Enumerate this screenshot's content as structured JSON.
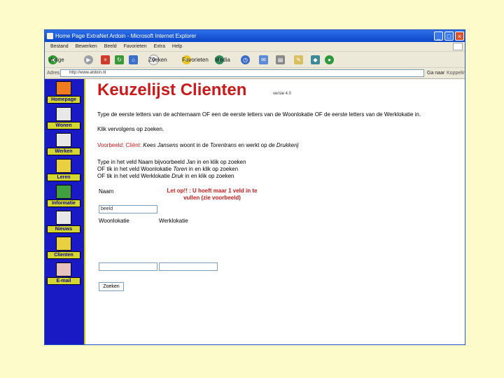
{
  "window": {
    "title": "Home Page ExtraNet Ardoin - Microsoft Internet Explorer",
    "minimize": "_",
    "maximize": "□",
    "close": "×"
  },
  "menu": [
    "Bestand",
    "Bewerken",
    "Beeld",
    "Favorieten",
    "Extra",
    "Help"
  ],
  "toolbar": {
    "back": "Vorige",
    "search": "Zoeken",
    "favorites": "Favorieten",
    "media": "Media"
  },
  "address": {
    "label": "Adres",
    "value": "http://www.ardoin.nl",
    "go": "Ga naar",
    "links": "Koppelingen"
  },
  "sidebar": {
    "items": [
      {
        "label": "Homepage",
        "icon": "homepage-icon"
      },
      {
        "label": "Wonen",
        "icon": "house-icon"
      },
      {
        "label": "Werken",
        "icon": "work-icon"
      },
      {
        "label": "Leren",
        "icon": "book-icon"
      },
      {
        "label": "Informatie",
        "icon": "info-icon"
      },
      {
        "label": "Nieuws",
        "icon": "news-icon"
      },
      {
        "label": "Clienten",
        "icon": "people-icon"
      },
      {
        "label": "E-mail",
        "icon": "mail-icon"
      }
    ]
  },
  "page": {
    "title": "Keuzelijst Clienten",
    "version": "versie 4.0",
    "intro1": "Type de eerste letters van de achternaam OF een de eerste letters van de Woonlokatie OF de eerste letters van de Werklokatie in.",
    "intro2": "Klik vervolgens op zoeken.",
    "example_label": "Voorbeeld:",
    "example_text1": " Cliënt: ",
    "example_name": "Kees Jansens",
    "example_text2": " woont in de ",
    "example_place": "Torentrans",
    "example_text3": " en werkt op de ",
    "example_work": "Drukkerij",
    "line1_a": "Type in het veld Naam bijvoorbeeld ",
    "line1_b": "Jan",
    "line1_c": " in en klik op zoeken",
    "line2_a": "OF tik in het veld Woonlokatie ",
    "line2_b": "Toren",
    "line2_c": " in en klik op zoeken",
    "line3_a": "OF tik in het veld Werklokatie ",
    "line3_b": "Druk",
    "line3_c": " in en klik op zoeken",
    "naam_label": "Naam",
    "warning": "Let op!! : U hoeft maar 1 veld in te vullen (zie voorbeeld)",
    "naam_value": "beeld",
    "woon_label": "Woonlokatie",
    "werk_label": "Werklokatie",
    "search_button": "Zoeken"
  }
}
